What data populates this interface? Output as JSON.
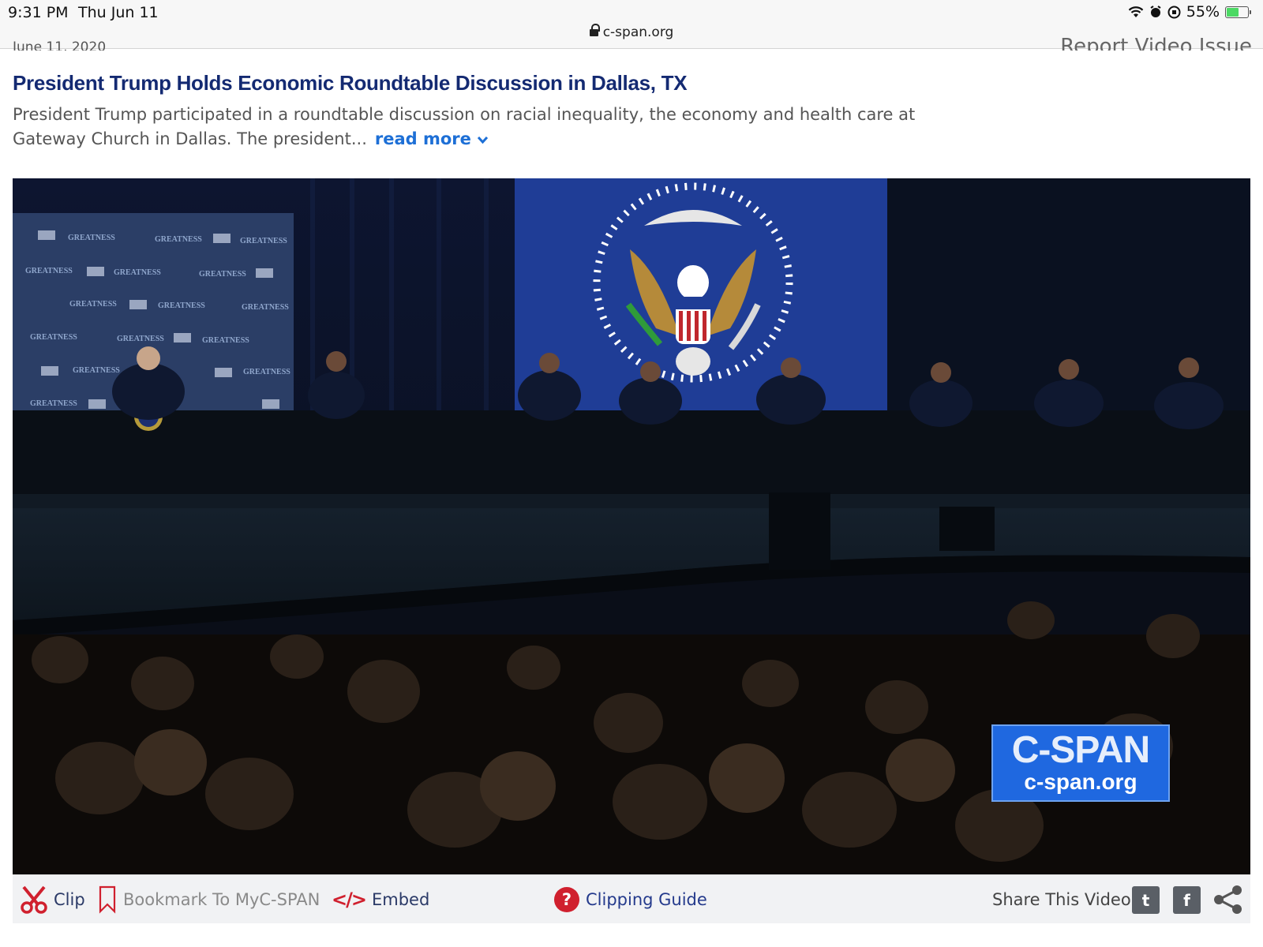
{
  "status_bar": {
    "time": "9:31 PM",
    "date": "Thu Jun 11",
    "battery": "55%",
    "battery_level": 0.55,
    "url": "c-span.org"
  },
  "page": {
    "clipped_left": "June 11, 2020",
    "clipped_right": "Report Video Issue",
    "headline": "President Trump Holds Economic Roundtable Discussion in Dallas, TX",
    "description": "President Trump participated in a roundtable discussion on racial inequality, the economy and health care at Gateway Church in Dallas. The president...",
    "read_more": "read more"
  },
  "video": {
    "logo_title": "C-SPAN",
    "logo_url": "c-span.org",
    "backdrop_text": "GREATNESS"
  },
  "toolbar": {
    "clip": "Clip",
    "bookmark": "Bookmark To MyC-SPAN",
    "embed": "Embed",
    "embed_glyph": "</>",
    "clipping_guide": "Clipping Guide",
    "help_glyph": "?",
    "share_label": "Share This Video",
    "twitter_glyph": "t",
    "facebook_glyph": "f"
  },
  "colors": {
    "headline": "#142a72",
    "read_more": "#1d6fd6",
    "cspan_blue": "#1f68e0",
    "clip_red": "#d0202e"
  }
}
